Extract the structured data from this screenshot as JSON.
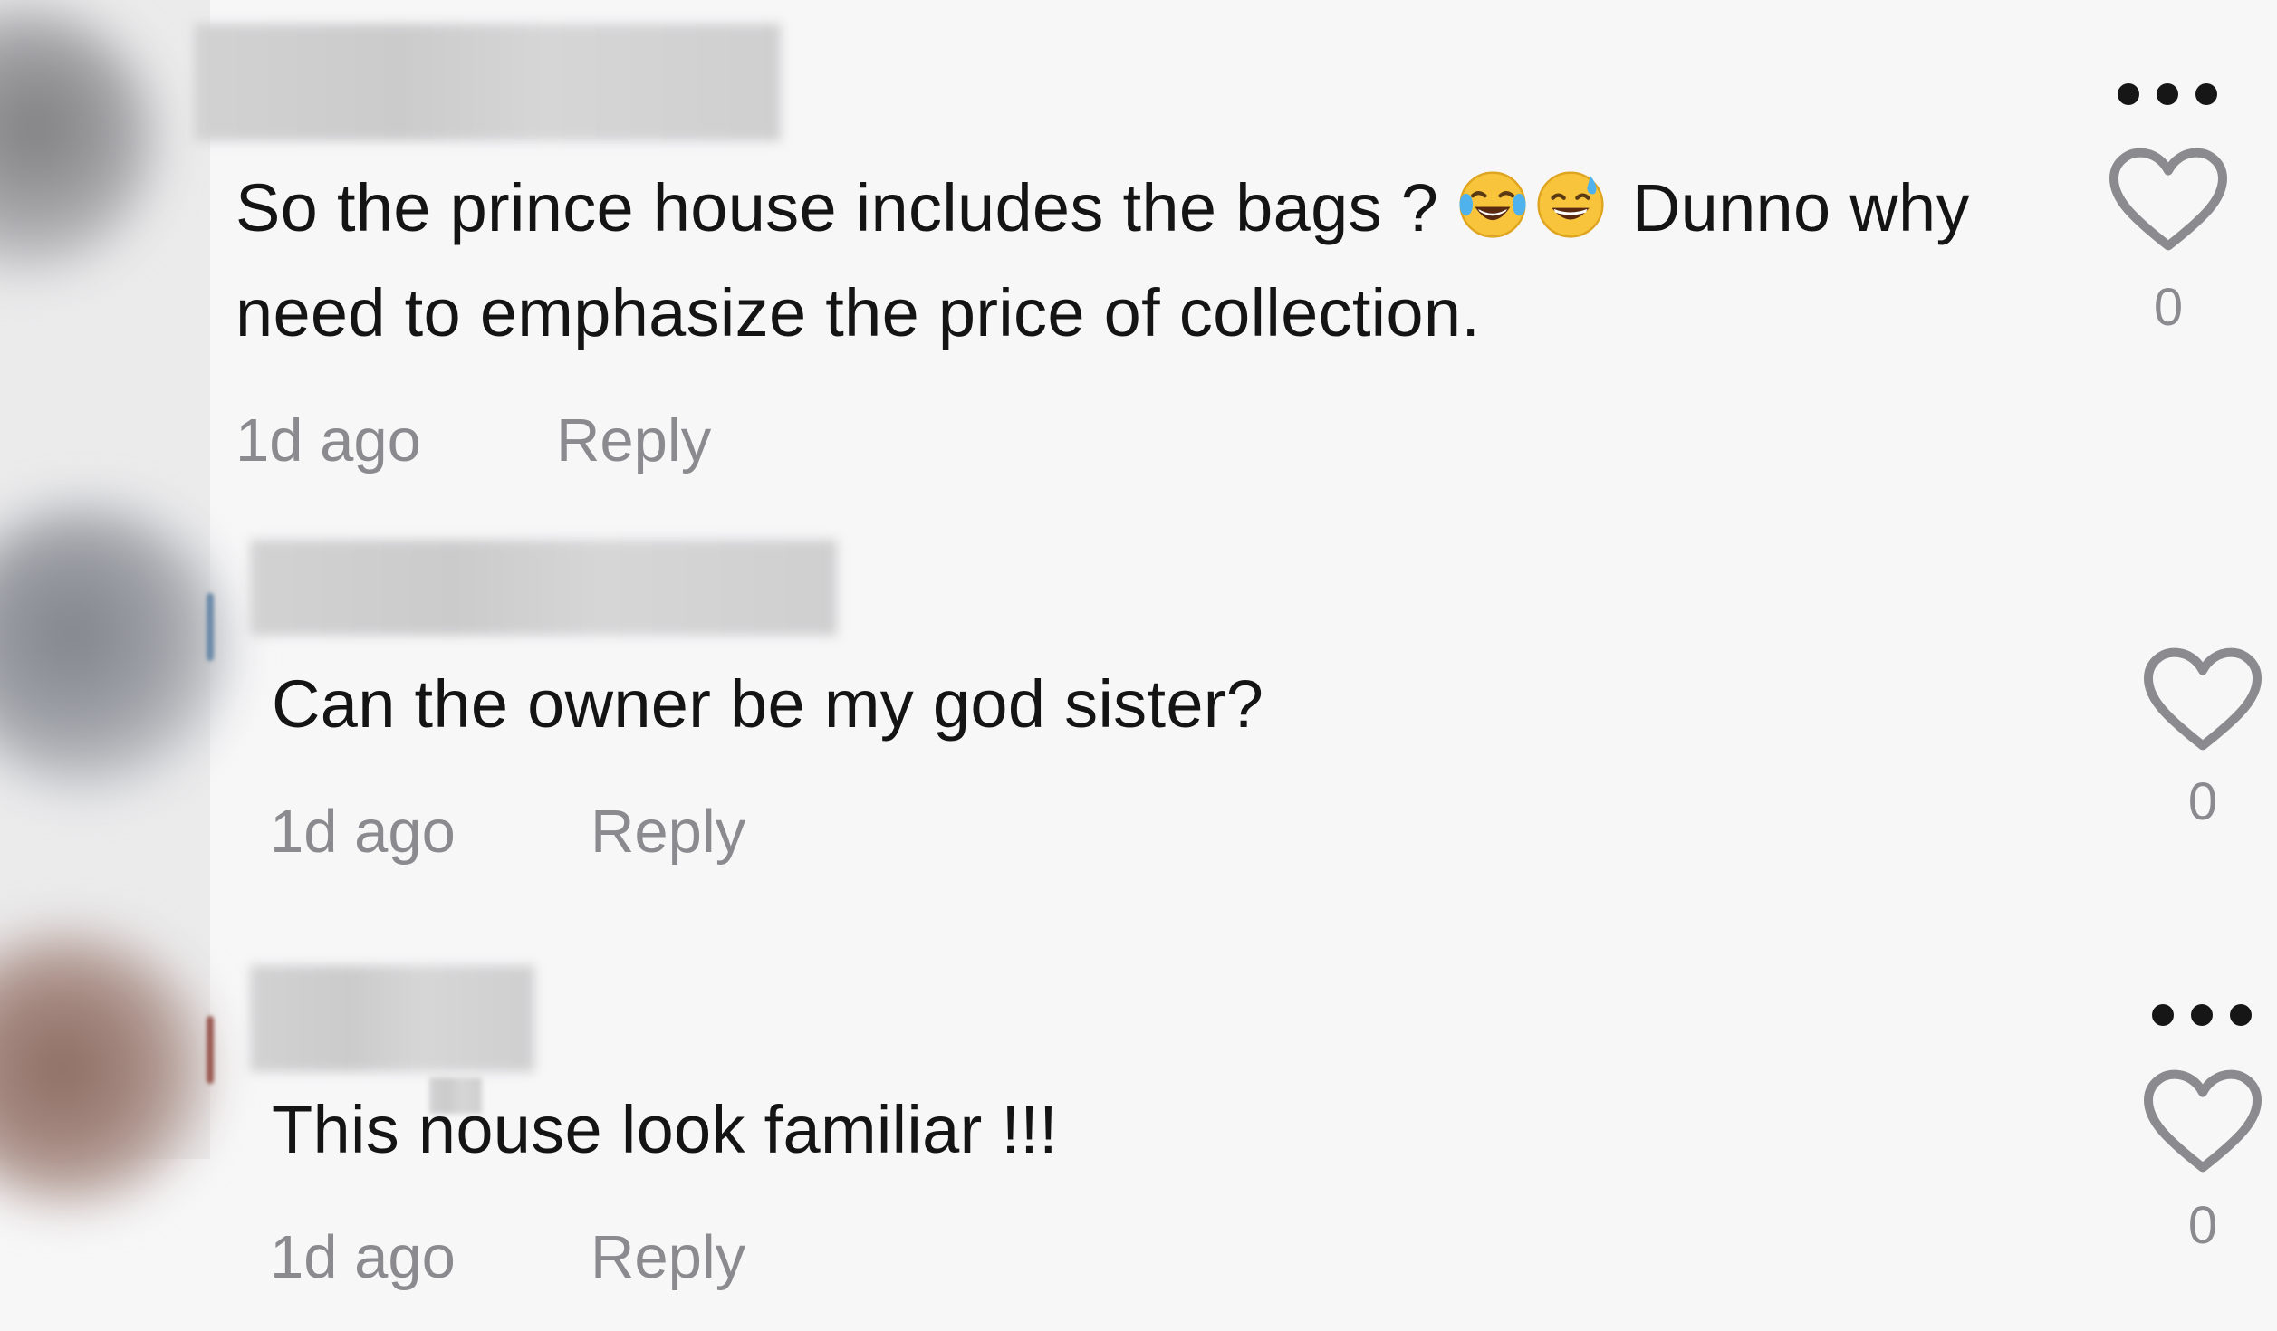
{
  "comments": [
    {
      "text_before_emoji": "So the prince house includes the bags ? ",
      "emojis": [
        "face-with-tears-of-joy-icon",
        "grinning-face-with-sweat-icon"
      ],
      "text_after_emoji": " Dunno why need to emphasize the price of collection.",
      "time": "1d ago",
      "reply_label": "Reply",
      "like_count": "0"
    },
    {
      "text": "Can the owner be my god sister?",
      "time": "1d ago",
      "reply_label": "Reply",
      "like_count": "0"
    },
    {
      "text": "This nouse look familiar !!!",
      "time": "1d ago",
      "reply_label": "Reply",
      "like_count": "0"
    }
  ],
  "icons": {
    "more": "more-options-icon",
    "heart": "heart-icon"
  },
  "colors": {
    "background": "#f7f7f8",
    "text": "#141414",
    "meta": "#8b8b8f",
    "icon": "#8b8b8f"
  }
}
